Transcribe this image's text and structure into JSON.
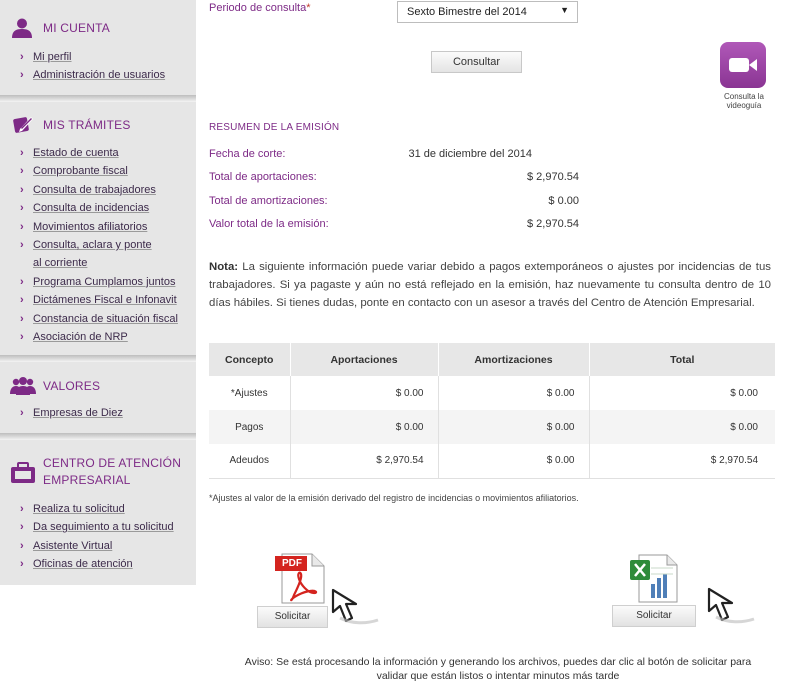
{
  "sidebar": {
    "cuenta": {
      "title": "MI CUENTA",
      "icon": "user-icon",
      "items": [
        "Mi perfil",
        "Administración de usuarios"
      ]
    },
    "tramites": {
      "title": "MIS TRÁMITES",
      "icon": "pencil-icon",
      "items": [
        "Estado de cuenta",
        "Comprobante fiscal",
        "Consulta de trabajadores",
        "Consulta de incidencias",
        "Movimientos afiliatorios",
        "Consulta, aclara y ponte al corriente",
        "Programa Cumplamos juntos",
        "Dictámenes Fiscal e Infonavit",
        "Constancia de situación fiscal",
        "Asociación de NRP"
      ]
    },
    "valores": {
      "title": "VALORES",
      "icon": "group-icon",
      "items": [
        "Empresas de Diez"
      ]
    },
    "centro": {
      "title_line1": "CENTRO DE ATENCIÓN",
      "title_line2": "EMPRESARIAL",
      "icon": "briefcase-icon",
      "items": [
        "Realiza tu solicitud",
        "Da seguimiento a tu solicitud",
        "Asistente Virtual",
        "Oficinas de atención"
      ]
    }
  },
  "form": {
    "period_label": "Periodo de consulta",
    "required_mark": "*",
    "period_value": "Sexto Bimestre del 2014",
    "consultar_label": "Consultar",
    "video_caption": "Consulta la videoguía"
  },
  "resumen": {
    "title": "RESUMEN DE LA EMISIÓN",
    "rows": [
      {
        "label": "Fecha de corte:",
        "value": "31 de diciembre del 2014"
      },
      {
        "label": "Total de aportaciones:",
        "value": "$ 2,970.54"
      },
      {
        "label": "Total de amortizaciones:",
        "value": "$ 0.00"
      },
      {
        "label": "Valor total de la emisión:",
        "value": "$ 2,970.54"
      }
    ]
  },
  "nota": {
    "bold": "Nota:",
    "text": " La siguiente información puede variar debido a pagos extemporáneos o ajustes por incidencias de tus trabajadores. Si ya pagaste y aún no está reflejado en la emisión, haz nuevamente tu consulta dentro de 10 días hábiles. Si tienes dudas, ponte en contacto con un asesor a través del Centro de Atención Empresarial."
  },
  "table": {
    "headers": [
      "Concepto",
      "Aportaciones",
      "Amortizaciones",
      "Total"
    ],
    "rows": [
      [
        "*Ajustes",
        "$ 0.00",
        "$ 0.00",
        "$ 0.00"
      ],
      [
        "Pagos",
        "$ 0.00",
        "$ 0.00",
        "$ 0.00"
      ],
      [
        "Adeudos",
        "$ 2,970.54",
        "$ 0.00",
        "$ 2,970.54"
      ]
    ]
  },
  "ajustes_note": "*Ajustes al valor de la emisión derivado del registro de incidencias o movimientos afiliatorios.",
  "downloads": {
    "pdf_badge": "PDF",
    "pdf_button": "Solicitar",
    "excel_button": "Solicitar"
  },
  "aviso_line1": "Aviso: Se está procesando la información y generando los archivos, puedes dar clic al botón de solicitar para",
  "aviso_line2": "validar que están listos o intentar minutos más tarde",
  "colors": {
    "accent": "#7d2a86",
    "sidebar_bg": "#e6e6e6",
    "pdf_red": "#d4241f",
    "excel_green": "#2e8b3a"
  }
}
